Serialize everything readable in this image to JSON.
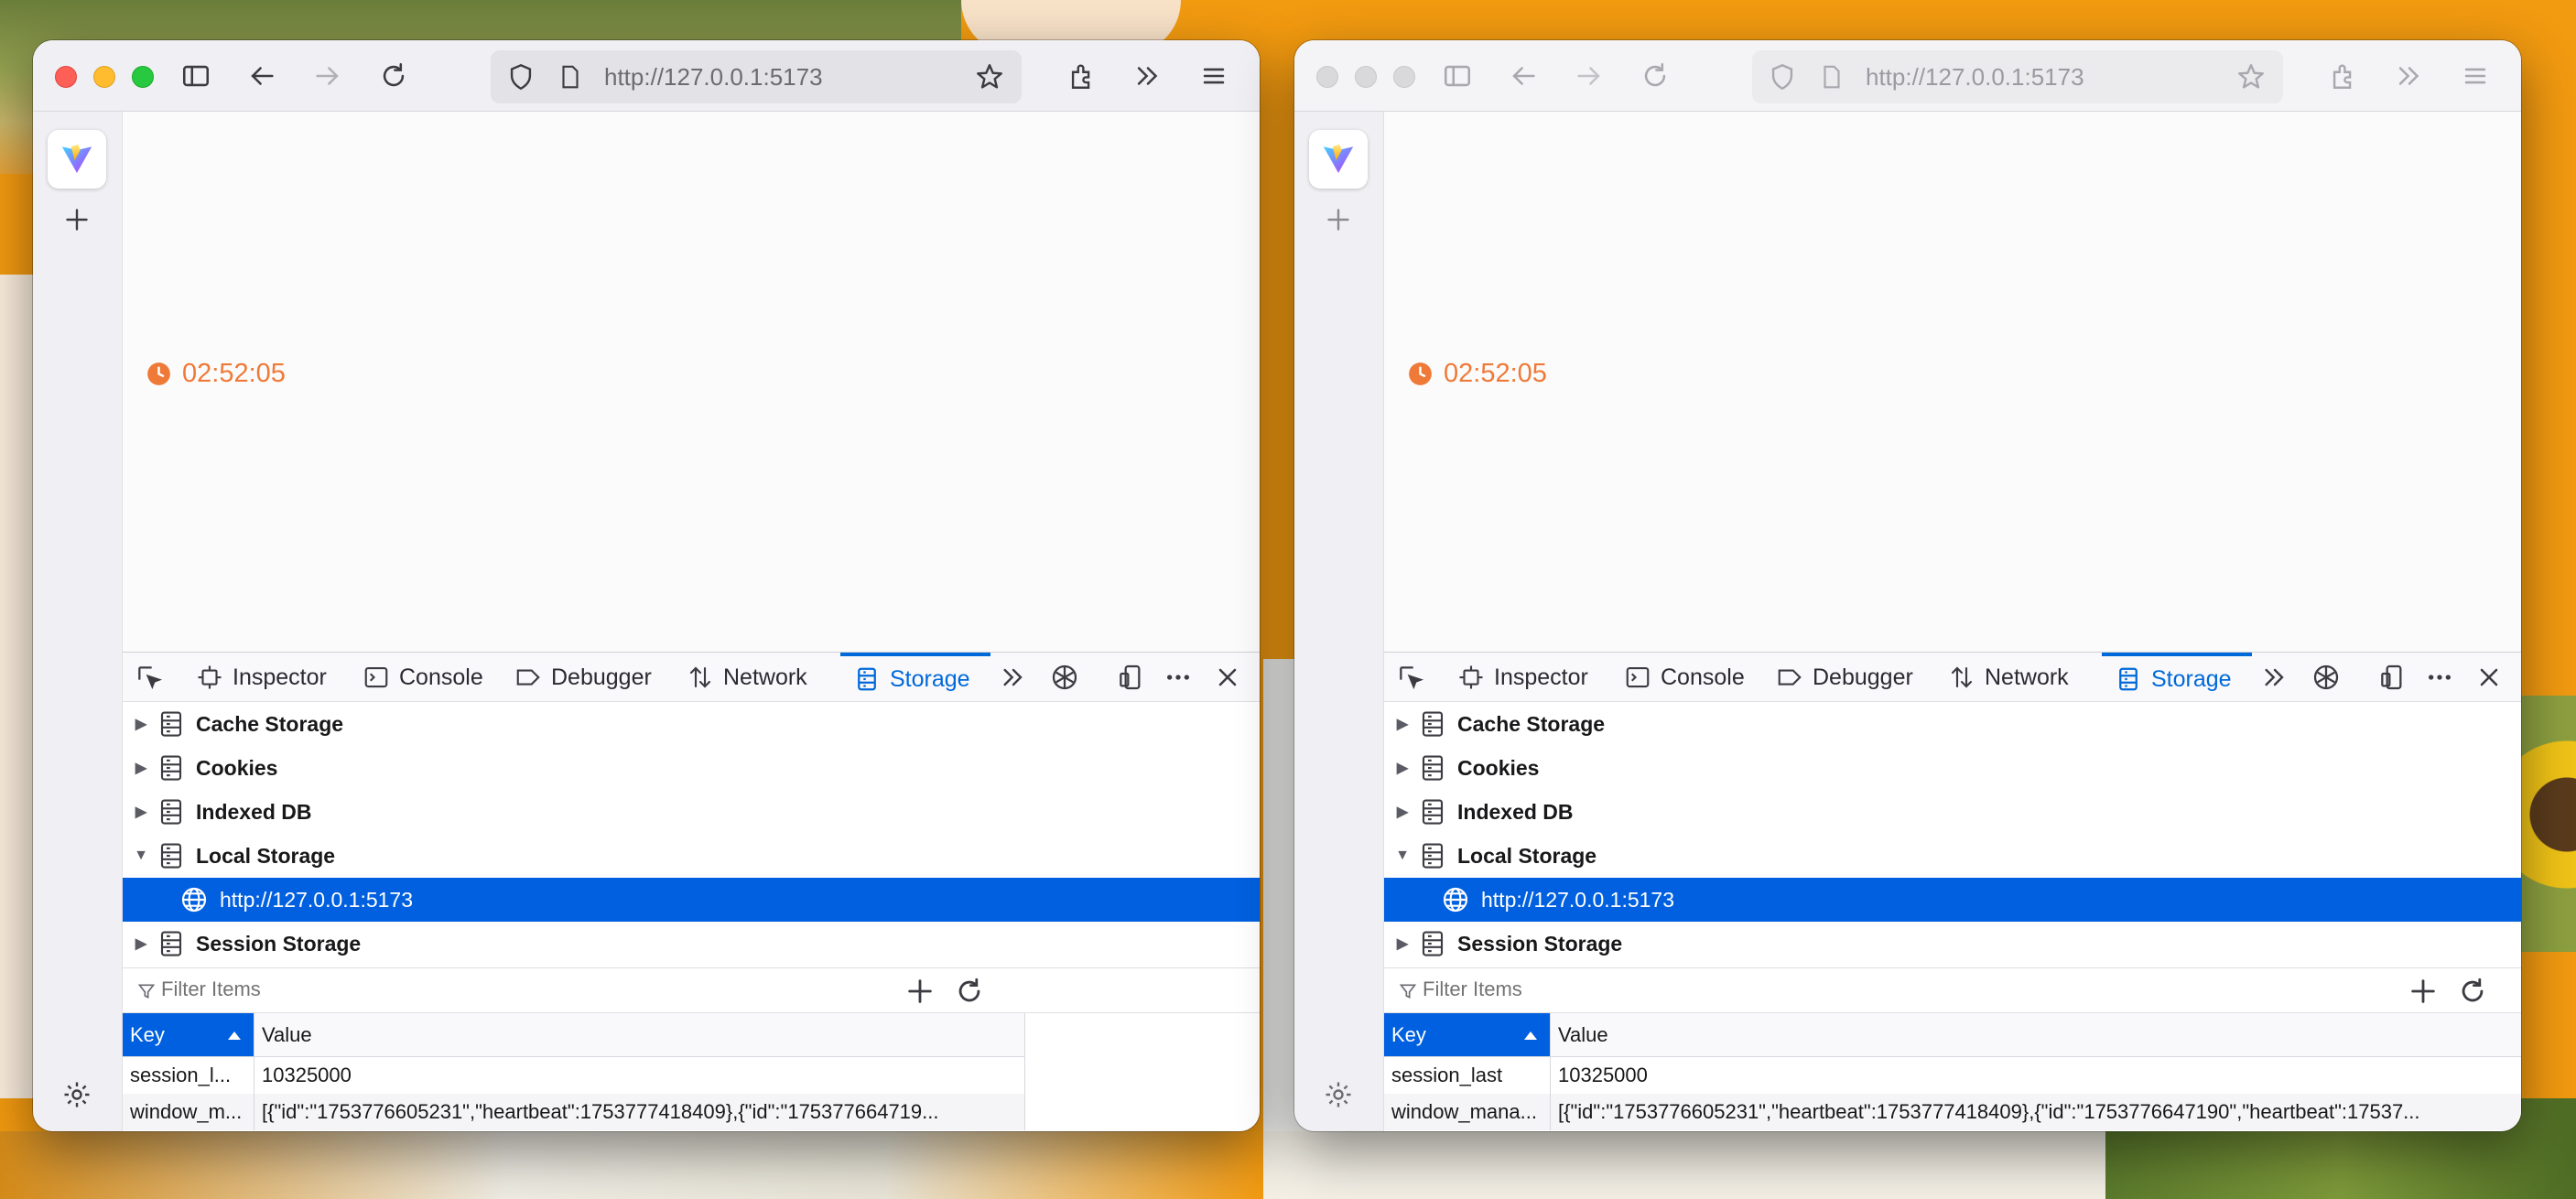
{
  "windows": [
    {
      "id": "left",
      "active": true,
      "url": "http://127.0.0.1:5173",
      "clock": "02:52:05",
      "devtools": {
        "tabs": [
          "Inspector",
          "Console",
          "Debugger",
          "Network",
          "Storage"
        ],
        "active_tab": "Storage",
        "tree": {
          "cache_storage": "Cache Storage",
          "cookies": "Cookies",
          "indexed_db": "Indexed DB",
          "local_storage": "Local Storage",
          "local_storage_origin": "http://127.0.0.1:5173",
          "session_storage": "Session Storage"
        },
        "filter_placeholder": "Filter Items",
        "table": {
          "headers": {
            "key": "Key",
            "value": "Value"
          },
          "rows": [
            {
              "key": "session_l...",
              "value": "10325000"
            },
            {
              "key": "window_m...",
              "value": "[{\"id\":\"1753776605231\",\"heartbeat\":1753777418409},{\"id\":\"175377664719..."
            }
          ]
        }
      }
    },
    {
      "id": "right",
      "active": false,
      "url": "http://127.0.0.1:5173",
      "clock": "02:52:05",
      "devtools": {
        "tabs": [
          "Inspector",
          "Console",
          "Debugger",
          "Network",
          "Storage"
        ],
        "active_tab": "Storage",
        "tree": {
          "cache_storage": "Cache Storage",
          "cookies": "Cookies",
          "indexed_db": "Indexed DB",
          "local_storage": "Local Storage",
          "local_storage_origin": "http://127.0.0.1:5173",
          "session_storage": "Session Storage"
        },
        "filter_placeholder": "Filter Items",
        "table": {
          "headers": {
            "key": "Key",
            "value": "Value"
          },
          "rows": [
            {
              "key": "session_last",
              "value": "10325000"
            },
            {
              "key": "window_mana...",
              "value": "[{\"id\":\"1753776605231\",\"heartbeat\":1753777418409},{\"id\":\"1753776647190\",\"heartbeat\":17537..."
            }
          ]
        }
      }
    }
  ],
  "colors": {
    "accent": "#0060df",
    "clock": "#ef7a38",
    "desktop": "#f29a10"
  },
  "icons": {
    "titlebar": [
      "sidebar-toggle-icon",
      "back-icon",
      "forward-icon",
      "reload-icon",
      "extensions-icon",
      "overflow-chevrons-icon",
      "menu-icon"
    ],
    "url": [
      "shield-icon",
      "page-icon",
      "star-icon"
    ],
    "devtools": [
      "element-picker-icon",
      "more-tools-icon",
      "accessibility-icon",
      "responsive-design-icon",
      "meatball-menu-icon",
      "close-icon"
    ]
  }
}
